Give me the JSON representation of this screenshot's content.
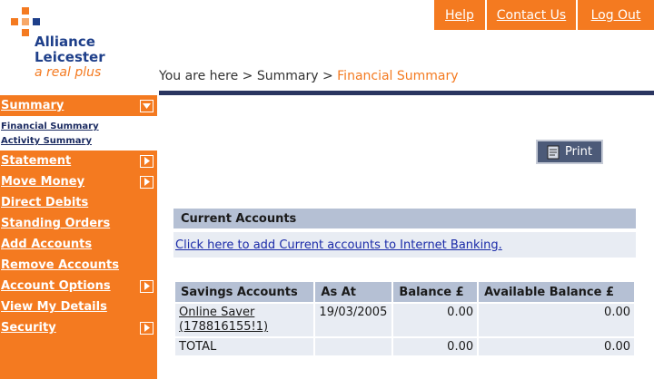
{
  "topnav": {
    "help": "Help",
    "contact": "Contact Us",
    "logout": "Log Out"
  },
  "logo": {
    "line1": "Alliance",
    "line2": "Leicester",
    "tagline": "a real plus"
  },
  "breadcrumb": {
    "prefix": "You are here > Summary > ",
    "current": "Financial Summary"
  },
  "sidebar": {
    "summary": "Summary",
    "sub_items": [
      "Financial Summary",
      "Activity Summary"
    ],
    "statement": "Statement",
    "move_money": "Move Money",
    "direct_debits": "Direct Debits",
    "standing_orders": "Standing Orders",
    "add_accounts": "Add Accounts",
    "remove_accounts": "Remove Accounts",
    "account_options": "Account Options",
    "view_details": "View My Details",
    "security": "Security"
  },
  "print_label": "Print",
  "current_accounts": {
    "heading": "Current Accounts",
    "link": "Click here to add Current accounts to Internet Banking."
  },
  "savings": {
    "headers": [
      "Savings Accounts",
      "As At",
      "Balance £",
      "Available Balance £"
    ],
    "row": {
      "name": "Online Saver",
      "number": "(178816155!1)",
      "date": "19/03/2005",
      "balance": "0.00",
      "available": "0.00"
    },
    "total": {
      "label": "TOTAL",
      "balance": "0.00",
      "available": "0.00"
    }
  },
  "colors": {
    "brand_orange": "#f47a20",
    "navy": "#2a3560",
    "header_blue": "#b5c0d4",
    "row_bg": "#e8ecf3"
  }
}
